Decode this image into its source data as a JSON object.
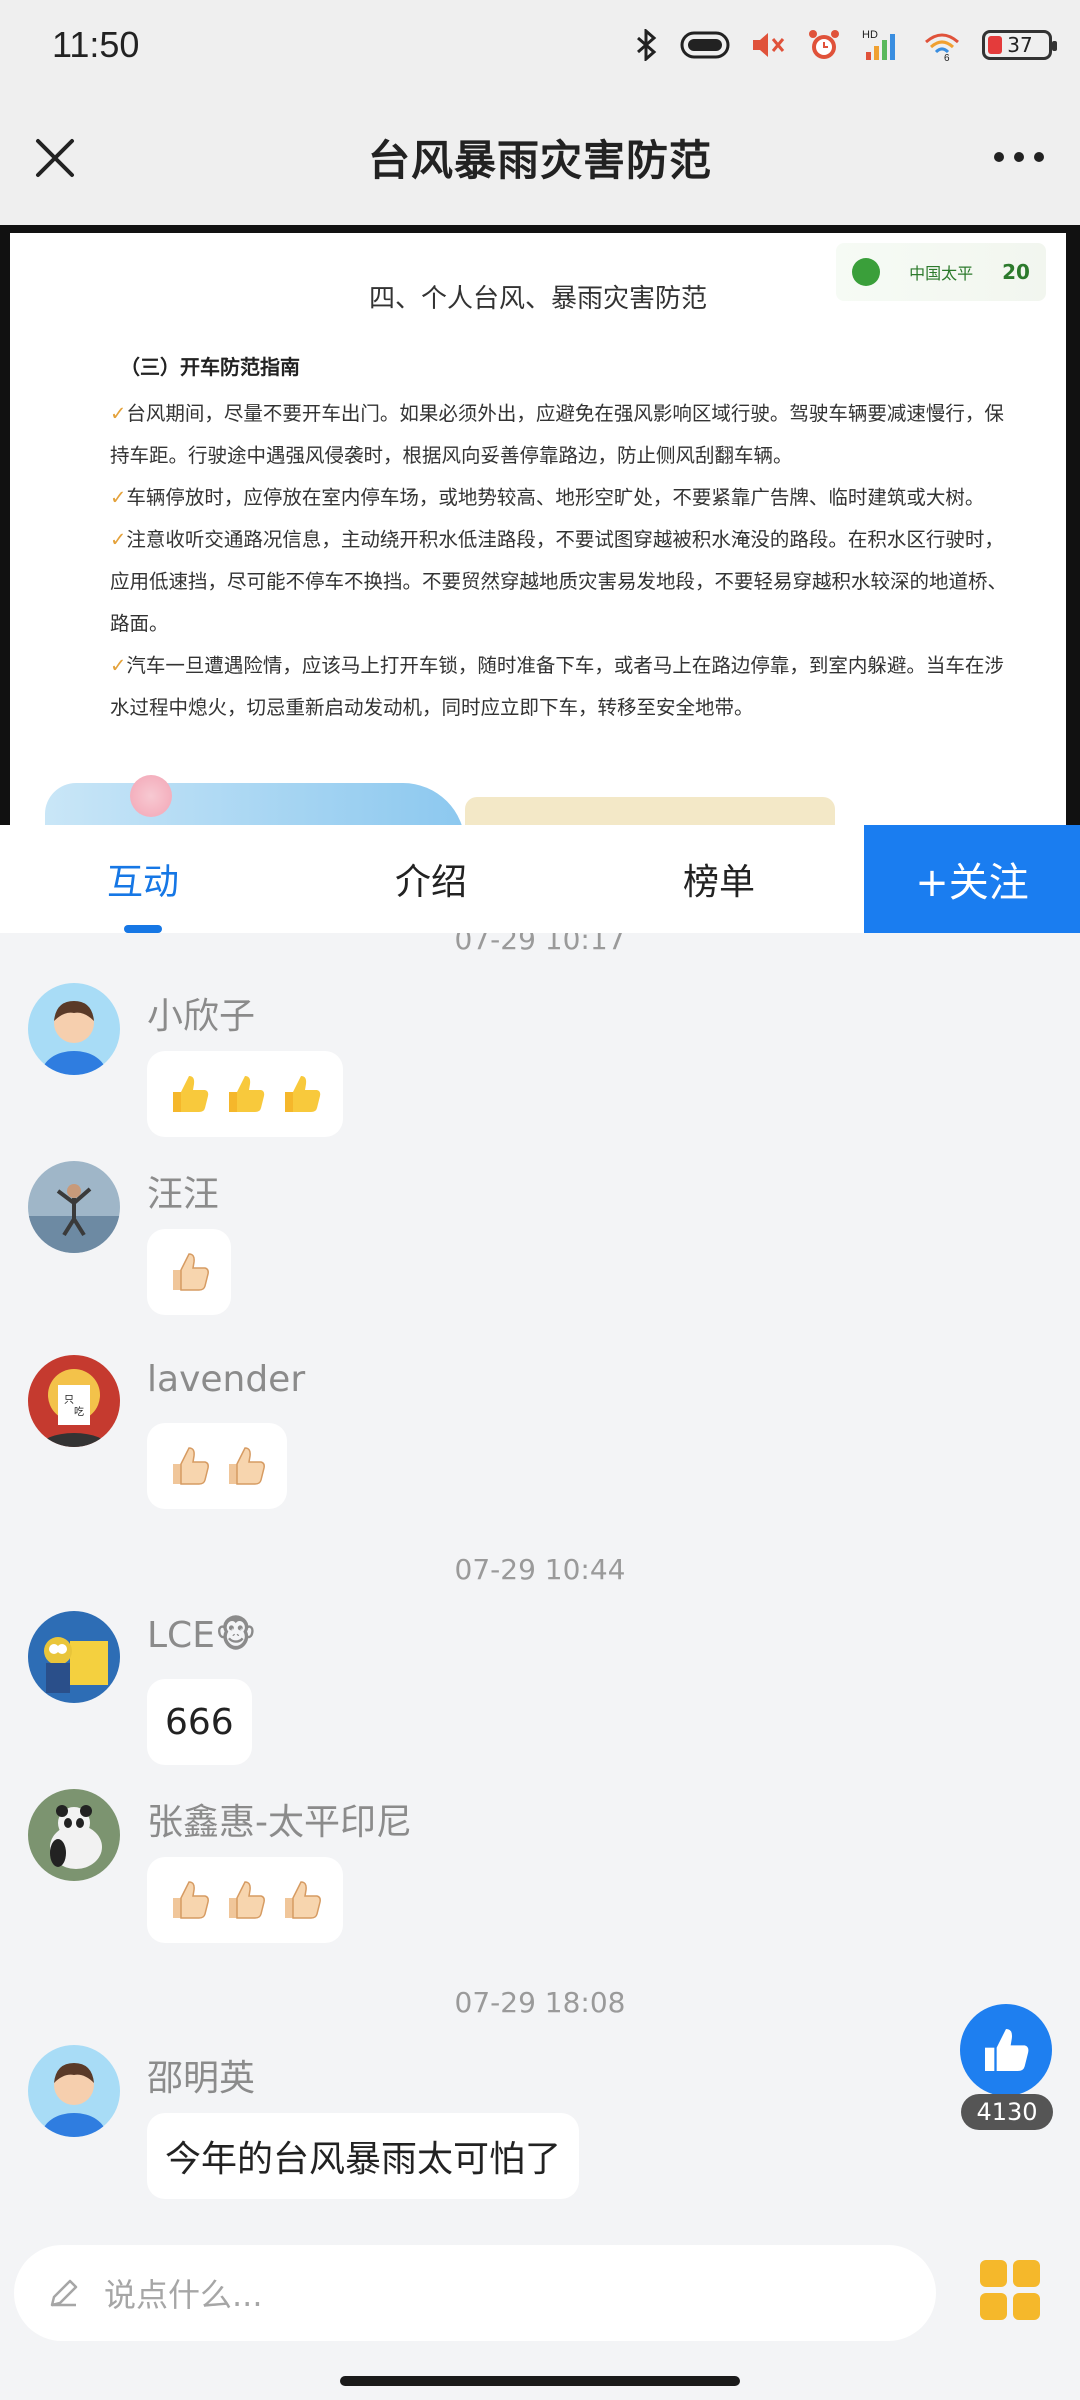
{
  "status_bar": {
    "time": "11:50",
    "battery": "37",
    "network": "HD",
    "wifi_count": "6",
    "icons": [
      "bluetooth-icon",
      "toggle-icon",
      "mute-icon",
      "alarm-icon",
      "signal-icon",
      "wifi-icon",
      "battery-icon"
    ]
  },
  "header": {
    "title": "台风暴雨灾害防范",
    "close_icon": "close-icon",
    "more_icon": "more-icon"
  },
  "document": {
    "logo_text": "中国太平",
    "logo_badge": "20",
    "heading": "四、个人台风、暴雨灾害防范",
    "subheading": "（三）开车防范指南",
    "paragraphs": [
      "✓台风期间，尽量不要开车出门。如果必须外出，应避免在强风影响区域行驶。驾驶车辆要减速慢行，保持车距。行驶途中遇强风侵袭时，根据风向妥善停靠路边，防止侧风刮翻车辆。",
      "✓车辆停放时，应停放在室内停车场，或地势较高、地形空旷处，不要紧靠广告牌、临时建筑或大树。",
      "✓注意收听交通路况信息，主动绕开积水低洼路段，不要试图穿越被积水淹没的路段。在积水区行驶时，应用低速挡，尽可能不停车不换挡。不要贸然穿越地质灾害易发地段，不要轻易穿越积水较深的地道桥、路面。",
      "✓汽车一旦遭遇险情，应该马上打开车锁，随时准备下车，或者马上在路边停靠，到室内躲避。当车在涉水过程中熄火，切忌重新启动发动机，同时应立即下车，转移至安全地带。"
    ]
  },
  "tabs": [
    {
      "label": "互动",
      "active": true
    },
    {
      "label": "介绍",
      "active": false
    },
    {
      "label": "榜单",
      "active": false
    }
  ],
  "follow_label": "+关注",
  "chat": {
    "timestamps": [
      "07-29 10:17",
      "07-29 10:44",
      "07-29 18:08"
    ],
    "messages": [
      {
        "user": "小欣子",
        "content": "👍👍👍",
        "thumbs": 3
      },
      {
        "user": "汪汪",
        "content": "👍",
        "thumbs": 1
      },
      {
        "user": "lavender",
        "content": "👍👍",
        "thumbs": 2
      },
      {
        "user": "LCE🐵",
        "content": "666",
        "thumbs": 0
      },
      {
        "user": "张鑫惠-太平印尼",
        "content": "👍👍👍",
        "thumbs": 3
      },
      {
        "user": "邵明英",
        "content": "今年的台风暴雨太可怕了",
        "thumbs": 0
      }
    ]
  },
  "like": {
    "count": "4130",
    "icon": "like-icon"
  },
  "input": {
    "placeholder": "说点什么...",
    "icon": "pencil-icon"
  },
  "colors": {
    "accent": "#1a7df0",
    "background": "#f3f4f6",
    "menu_icon": "#f5b82b"
  }
}
